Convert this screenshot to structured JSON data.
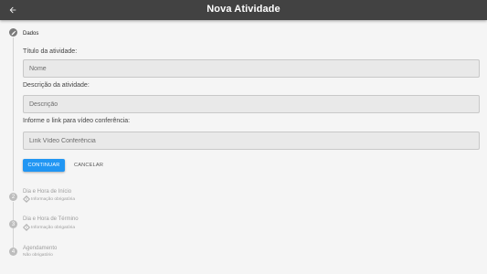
{
  "appbar": {
    "title": "Nova Atividade",
    "back_icon": "arrow-back-icon"
  },
  "steps": {
    "current": {
      "title": "Dados",
      "icon": "edit-pencil-icon"
    },
    "pending": [
      {
        "number": "2",
        "title": "Dia e Hora de Início",
        "subtitle": "Informação obrigatória",
        "icon": "warning-icon"
      },
      {
        "number": "3",
        "title": "Dia e Hora de Término",
        "subtitle": "Informação obrigatória",
        "icon": "warning-icon"
      },
      {
        "number": "4",
        "title": "Agendamento",
        "subtitle": "Não obrigatório"
      }
    ]
  },
  "form": {
    "title_label": "Título da atividade:",
    "title_placeholder": "Nome",
    "description_label": "Descrição da atividade:",
    "description_placeholder": "Descrição",
    "link_label": "Informe o link para vídeo conferência:",
    "link_placeholder": "Link Vídeo Conferência",
    "continue_label": "CONTINUAR",
    "cancel_label": "CANCELAR"
  },
  "colors": {
    "appbar": "#424242",
    "primary_button": "#2196f3",
    "background": "#f5f5f5"
  }
}
